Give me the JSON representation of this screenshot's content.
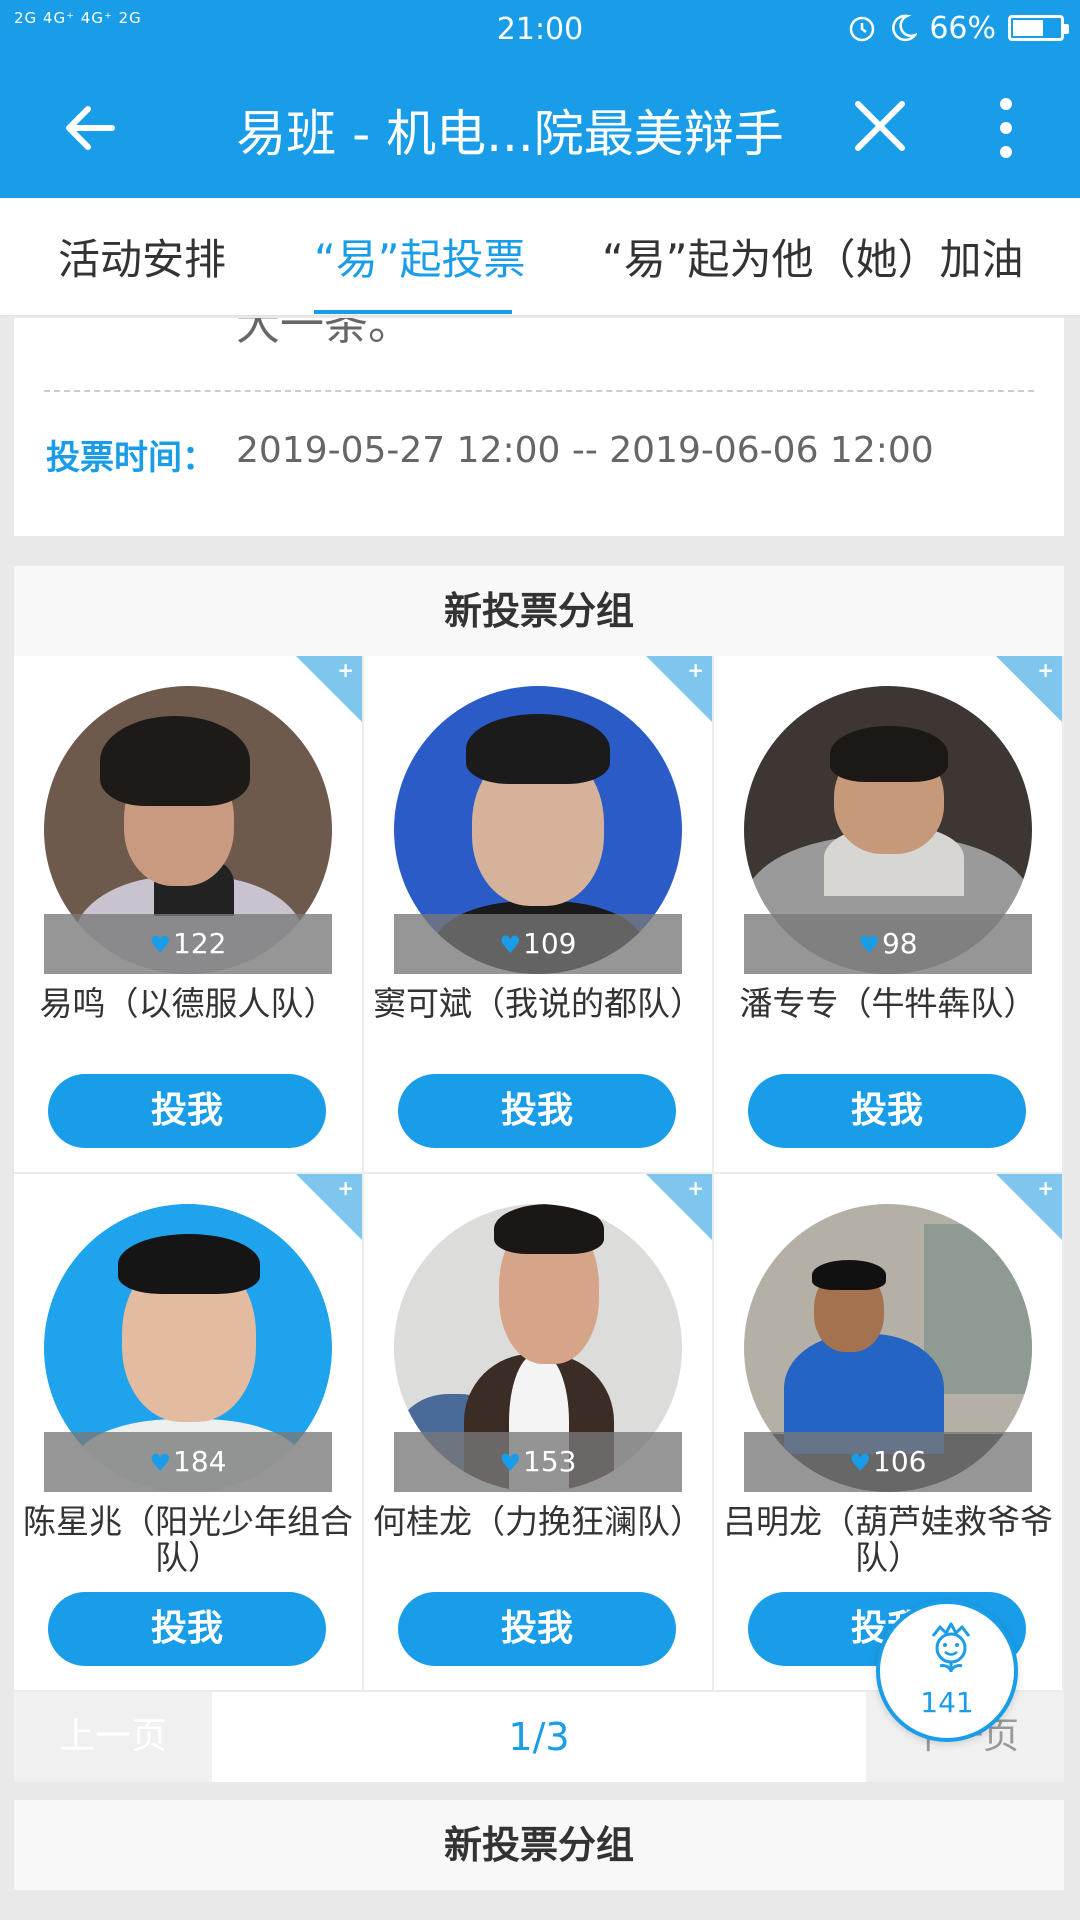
{
  "status_bar": {
    "signal_text": "2G 4G⁺ 4G⁺ 2G",
    "time": "21:00",
    "battery_percent": "66%",
    "battery_level": 0.66,
    "icons": [
      "signal-icon",
      "alarm-icon",
      "moon-icon",
      "battery-icon"
    ]
  },
  "header": {
    "title": "易班 - 机电...院最美辩手",
    "back_icon": "arrow-left-icon",
    "close_icon": "close-icon",
    "more_icon": "more-vertical-icon"
  },
  "tabs": [
    {
      "label": "活动安排",
      "active": false
    },
    {
      "label": "“易”起投票",
      "active": true
    },
    {
      "label": "“易”起为他（她）加油",
      "active": false
    }
  ],
  "info": {
    "clipped_text": "大一条。",
    "vote_time_label": "投票时间：",
    "vote_time_value": "2019-05-27 12:00 -- 2019-06-06 12:00"
  },
  "group": {
    "title": "新投票分组",
    "candidates": [
      {
        "name": "易鸣（以德服人队）",
        "votes": "122",
        "button": "投我"
      },
      {
        "name": "窦可斌（我说的都队）",
        "votes": "109",
        "button": "投我"
      },
      {
        "name": "潘专专（牛牪犇队）",
        "votes": "98",
        "button": "投我"
      },
      {
        "name": "陈星兆（阳光少年组合队）",
        "votes": "184",
        "button": "投我"
      },
      {
        "name": "何桂龙（力挽狂澜队）",
        "votes": "153",
        "button": "投我"
      },
      {
        "name": "吕明龙（葫芦娃救爷爷队）",
        "votes": "106",
        "button": "投我"
      }
    ],
    "corner_plus": "+",
    "pager": {
      "prev": "上一页",
      "page": "1/3",
      "next": "下一页"
    }
  },
  "floating": {
    "count": "141",
    "icon": "flower-face-icon"
  },
  "group2": {
    "title": "新投票分组"
  },
  "colors": {
    "primary": "#1a9de8",
    "corner": "#7fc6ef"
  }
}
